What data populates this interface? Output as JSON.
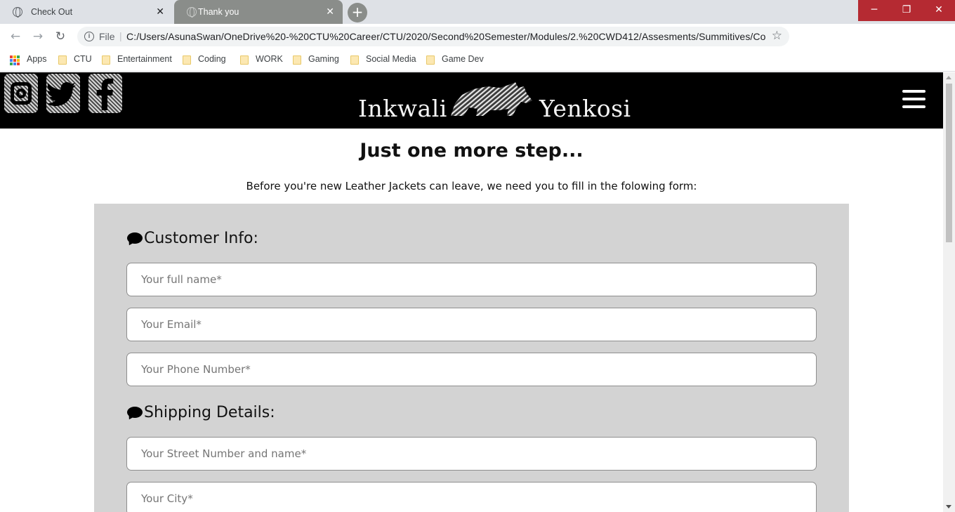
{
  "browser": {
    "tabs": [
      {
        "title": "Check Out",
        "active": false
      },
      {
        "title": "Thank you",
        "active": true
      }
    ],
    "new_tab_label": "+",
    "window_controls": {
      "minimize": "─",
      "restore": "❐",
      "close": "✕"
    },
    "address_bar": {
      "scheme_label": "File",
      "url": "C:/Users/AsunaSwan/OneDrive%20-%20CTU%20Career/CTU/2020/Second%20Semester/Modules/2.%20CWD412/Assesments/Summitives/Code..."
    },
    "bookmarks": [
      "Apps",
      "CTU",
      "Entertainment",
      "Coding",
      "WORK",
      "Gaming",
      "Social Media",
      "Game Dev"
    ]
  },
  "site": {
    "logo_left": "Inkwali",
    "logo_right": "Yenkosi",
    "social_icons": [
      "instagram-icon",
      "twitter-icon",
      "facebook-icon"
    ]
  },
  "page": {
    "title": "Just one more step...",
    "subtitle": "Before you're new Leather Jackets can leave, we need you to fill in the folowing form:"
  },
  "form": {
    "customer_section_title": "Customer Info:",
    "customer_fields": [
      {
        "placeholder": "Your full name*",
        "value": ""
      },
      {
        "placeholder": "Your Email*",
        "value": ""
      },
      {
        "placeholder": "Your Phone Number*",
        "value": ""
      }
    ],
    "shipping_section_title": "Shipping Details:",
    "shipping_fields": [
      {
        "placeholder": "Your Street Number and name*",
        "value": ""
      },
      {
        "placeholder": "Your City*",
        "value": ""
      }
    ]
  },
  "colors": {
    "header_bg": "#000000",
    "form_bg": "#d3d3d3",
    "active_tab": "#8a8d8a",
    "window_controls": "#b52a32"
  }
}
